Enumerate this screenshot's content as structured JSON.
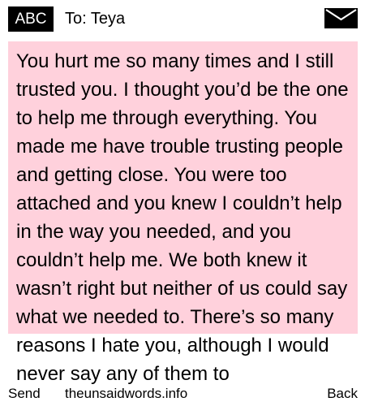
{
  "header": {
    "mode": "ABC",
    "recipient": "To: Teya",
    "icon": "envelope-icon"
  },
  "message": {
    "text": "You hurt me so many times and I still trusted you. I thought you’d be the one to help me through everything. You made me have trouble trusting people and getting close. You were too attached and you knew I couldn’t help in the way you needed, and you couldn’t help me. We both knew it wasn’t right but neither of us could say what we needed to. There’s so many reasons I hate you, although I would never say any of them to"
  },
  "softkeys": {
    "left": "Send",
    "center": "theunsaidwords.info",
    "right": "Back"
  },
  "colors": {
    "message_background": "#ffd1dc",
    "badge_background": "#000000"
  }
}
